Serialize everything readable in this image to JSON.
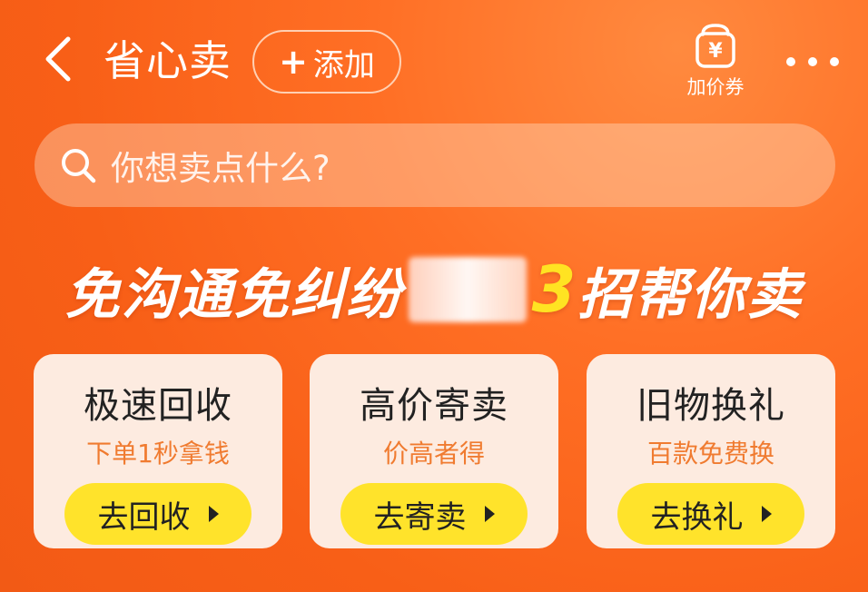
{
  "header": {
    "title": "省心卖",
    "add_label": "添加",
    "add_plus": "+",
    "coupon_label": "加价券",
    "coupon_symbol": "¥"
  },
  "search": {
    "placeholder": "你想卖点什么?"
  },
  "headline": {
    "part1": "免沟通免纠纷",
    "number": "3",
    "part2": "招帮你卖"
  },
  "cards": [
    {
      "title": "极速回收",
      "subtitle": "下单1秒拿钱",
      "button": "去回收"
    },
    {
      "title": "高价寄卖",
      "subtitle": "价高者得",
      "button": "去寄卖"
    },
    {
      "title": "旧物换礼",
      "subtitle": "百款免费换",
      "button": "去换礼"
    }
  ],
  "colors": {
    "background": "#f85f17",
    "accent_yellow": "#ffe32b",
    "card_bg": "#fdebe0",
    "subtitle_orange": "#f07b30"
  }
}
